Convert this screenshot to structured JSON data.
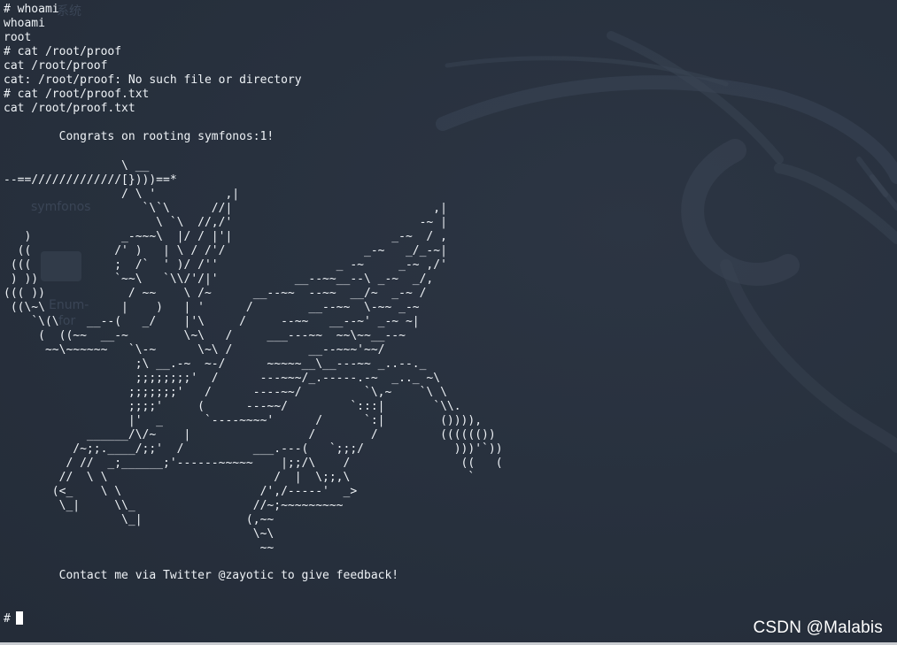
{
  "colors": {
    "background": "#27303d",
    "terminal_text": "#eef2f6",
    "desktop_faint": "#3a4556",
    "dragon_tint": "#3b4656"
  },
  "desktop": {
    "icon_label_1": "symfonos",
    "icon_label_2": "Enum-",
    "icon_label_3": "for"
  },
  "terminal": {
    "lines": [
      "# whoami",
      "whoami",
      "root",
      "# cat /root/proof",
      "cat /root/proof",
      "cat: /root/proof: No such file or directory",
      "# cat /root/proof.txt",
      "cat /root/proof.txt",
      "",
      "        Congrats on rooting symfonos:1!"
    ],
    "ascii_art": "                 \\ __\n--==/////////////[})))==*\n                 / \\ '          ,|\n                    `\\`\\      //|                             ,|\n                      \\ `\\  //,/'                           -~ |\n   )             _-~~~\\  |/ / |'|                       _-~  / ,\n  ((            /' )   | \\ / /'/                    _-~   _/_-~|\n (((            ;  /`  ' )/ /''                 _ -~     _-~ ,/'\n ) ))           `~~\\   `\\\\/'/|'           __--~~__--\\ _-~  _/,\n((( ))            / ~~    \\ /~      __--~~  --~~  __/~  _-~ /\n ((\\~\\           |    )   | '      /        __--~~  \\-~~ _-~\n    `\\(\\    __--(   _/    |'\\     /     --~~   __--~' _-~ ~|\n     (  ((~~  __-~        \\~\\   /     ___---~~  ~~\\~~__--~\n      ~~\\~~~~~~   `\\-~      \\~\\ /           __--~~~'~~/\n                   ;\\ __.-~  ~-/      ~~~~~__\\__---~~ _..--._\n                   ;;;;;;;;'  /      ---~~~/_.-----.-~  _.._ ~\\\n                  ;;;;;;;'   /      ----~~/         `\\,~    `\\ \\\n                  ;;;;'     (      ---~~/         `:::|       `\\\\.\n                  |'  _      `----~~~~'      /      `:|        ()))),\n            ______/\\/~    |                 /        /         (((((())\n          /~;;.____/;;'  /          ___.---(   `;;;/             )))'`))\n         / //  _;______;'------~~~~~    |;;/\\    /                ((   (\n        //  \\ \\                        /  |  \\;;,\\                 `\n       (<_    \\ \\                    /',/-----'  _>\n        \\_|     \\\\_                 //~;~~~~~~~~~\n                 \\_|               (,~~\n                                    \\~\\\n                                     ~~",
    "footer_text": "        Contact me via Twitter @zayotic to give feedback!",
    "prompt": "#"
  },
  "watermark": "CSDN @Malabis"
}
